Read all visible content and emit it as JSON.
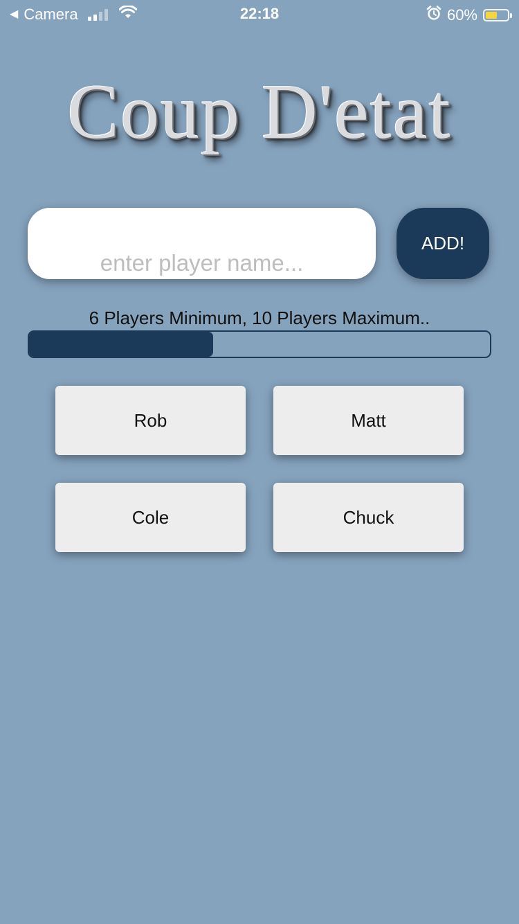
{
  "status_bar": {
    "carrier": "Camera",
    "time": "22:18",
    "battery_percent": "60%",
    "battery_level": 0.6,
    "signal_bars": 2,
    "icons": [
      "back-caret-icon",
      "signal-icon",
      "wifi-icon",
      "alarm-icon",
      "battery-icon"
    ]
  },
  "title": "Coup D'etat",
  "input": {
    "value": "",
    "placeholder": "enter player name..."
  },
  "add_button_label": "ADD!",
  "hint": "6 Players Minimum, 10 Players Maximum..",
  "progress": {
    "fraction": 0.4
  },
  "players": [
    {
      "name": "Rob"
    },
    {
      "name": "Matt"
    },
    {
      "name": "Cole"
    },
    {
      "name": "Chuck"
    }
  ],
  "colors": {
    "background": "#86a3be",
    "accent": "#1b3a5a",
    "card": "#ededed",
    "battery": "#f5d73c"
  }
}
